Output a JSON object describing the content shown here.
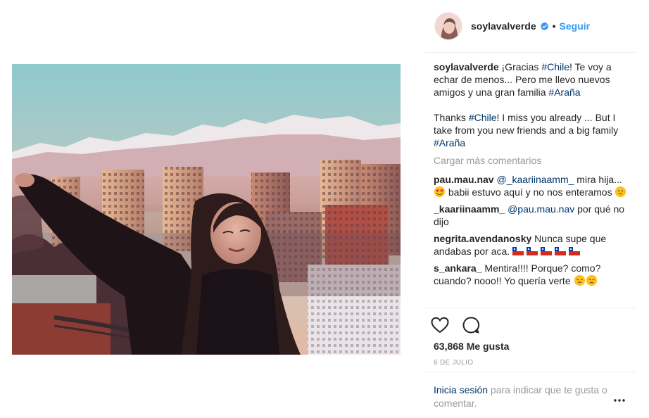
{
  "post": {
    "username": "soylavalverde",
    "follow_separator": "•",
    "follow_label": "Seguir",
    "caption": {
      "username": "soylavalverde",
      "es_part1": " ¡Gracias ",
      "es_tag1": "#Chile",
      "es_part2": "! Te voy a echar de menos... Pero me llevo nuevos amigos y una gran familia ",
      "es_tag2": "#Araña",
      "en_part1": "Thanks ",
      "en_tag1": "#Chile",
      "en_part2": "! I miss you already ... But I take from you new friends and a big family ",
      "en_tag2": "#Araña"
    },
    "load_more_label": "Cargar más comentarios",
    "comments": [
      {
        "user": "pau.mau.nav",
        "mention": "@_kaariinaamm_",
        "text1": " mira hija... ",
        "text2": " babii estuvo aquí y no nos enteramos "
      },
      {
        "user": "_kaariinaamm_",
        "mention": "@pau.mau.nav",
        "text1": " por qué no dijo"
      },
      {
        "user": "negrita.avendanosky",
        "text1": " Nunca supe que andabas por aca. "
      },
      {
        "user": "s_ankara_",
        "text1": " Mentira!!!! Porque? como? cuando? nooo!! Yo quería verte "
      }
    ],
    "likes_label": "63,868 Me gusta",
    "date_label": "6 DE JULIO",
    "login_link": "Inicia sesión",
    "login_text": " para indicar que te gusta o comentar."
  },
  "icons": {
    "verified": "verified-badge-icon",
    "like": "heart-icon",
    "comment": "speech-bubble-icon",
    "options": "more-options-icon"
  },
  "colors": {
    "link_blue": "#3897f0",
    "hashtag_navy": "#003569",
    "muted": "#999999",
    "divider": "#efefef"
  }
}
